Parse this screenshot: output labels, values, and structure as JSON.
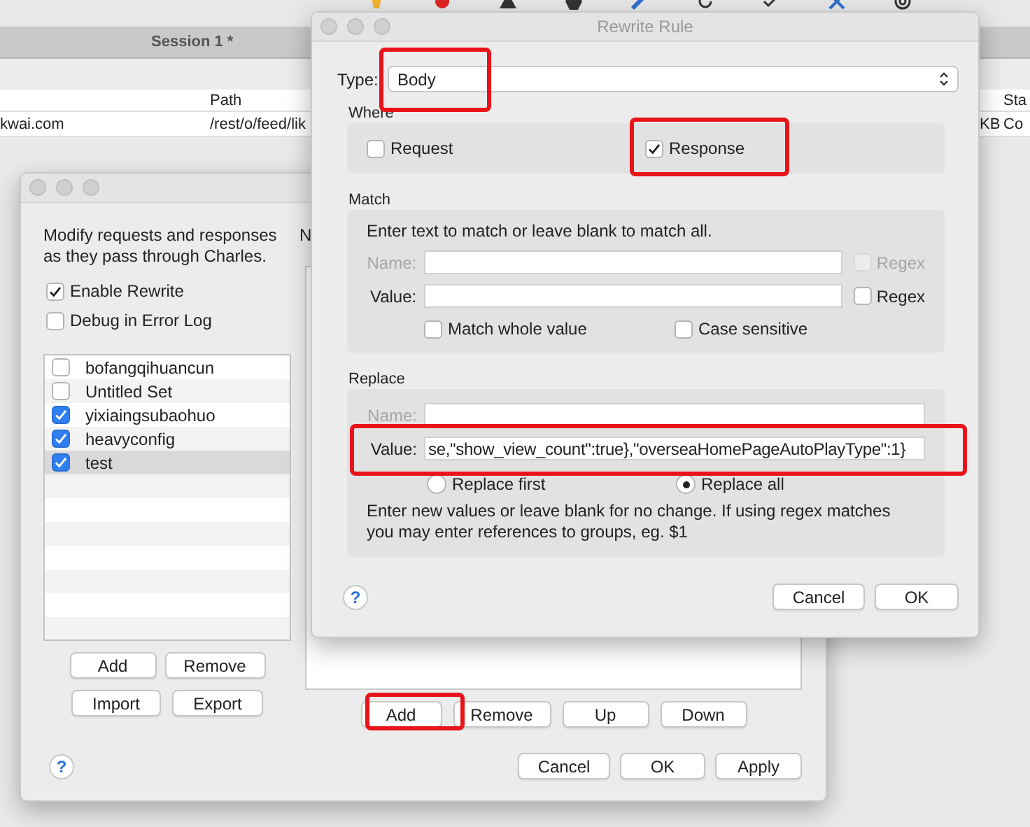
{
  "main_window": {
    "session_tab": "Session 1 *",
    "columns": [
      {
        "label": "Path"
      },
      {
        "label": "Sta"
      }
    ],
    "row": [
      "kwai.com",
      "/rest/o/feed/lik",
      "KB",
      "Co"
    ]
  },
  "rewrite_settings": {
    "description": [
      "Modify requests and responses",
      "as they pass through Charles."
    ],
    "options": [
      {
        "label": "Enable Rewrite",
        "checked": true
      },
      {
        "label": "Debug in Error Log",
        "checked": false
      }
    ],
    "sets": [
      {
        "name": "bofangqihuancun",
        "checked": false,
        "selected": false
      },
      {
        "name": "Untitled Set",
        "checked": false,
        "selected": false
      },
      {
        "name": "yixiaingsubaohuo",
        "checked": true,
        "selected": false
      },
      {
        "name": "heavyconfig",
        "checked": true,
        "selected": false
      },
      {
        "name": "test",
        "checked": true,
        "selected": true
      }
    ],
    "list_buttons": [
      "Add",
      "Remove",
      "Import",
      "Export"
    ],
    "right_label": "N",
    "rule_buttons": [
      {
        "label": "Add",
        "highlighted": true
      },
      {
        "label": "Remove",
        "highlighted": false
      },
      {
        "label": "Up",
        "highlighted": false
      },
      {
        "label": "Down",
        "highlighted": false
      }
    ],
    "help": "?",
    "footer_buttons": [
      "Cancel",
      "OK",
      "Apply"
    ]
  },
  "rewrite_rule": {
    "title": "Rewrite Rule",
    "type": {
      "label": "Type:",
      "value": "Body",
      "highlighted": true
    },
    "where": {
      "title": "Where",
      "options": [
        {
          "label": "Request",
          "checked": false,
          "highlighted": false
        },
        {
          "label": "Response",
          "checked": true,
          "highlighted": true
        }
      ]
    },
    "match": {
      "title": "Match",
      "hint": "Enter text to match or leave blank to match all.",
      "fields": [
        {
          "label": "Name:",
          "disabled": true,
          "regex": {
            "label": "Regex",
            "checked": false,
            "disabled": true
          }
        },
        {
          "label": "Value:",
          "disabled": false,
          "regex": {
            "label": "Regex",
            "checked": false,
            "disabled": false
          }
        }
      ],
      "options": [
        {
          "label": "Match whole value",
          "checked": false
        },
        {
          "label": "Case sensitive",
          "checked": false
        }
      ]
    },
    "replace": {
      "title": "Replace",
      "fields": [
        {
          "label": "Name:",
          "disabled": true,
          "highlighted": false
        },
        {
          "label": "Value:",
          "disabled": false,
          "value": "se,\"show_view_count\":true},\"overseaHomePageAutoPlayType\":1}",
          "highlighted": true
        }
      ],
      "modes": [
        {
          "label": "Replace first",
          "selected": false
        },
        {
          "label": "Replace all",
          "selected": true
        }
      ],
      "hint": [
        "Enter new values or leave blank for no change. If using regex matches",
        "you may enter references to groups, eg. $1"
      ]
    },
    "help": "?",
    "buttons": [
      "Cancel",
      "OK"
    ]
  }
}
